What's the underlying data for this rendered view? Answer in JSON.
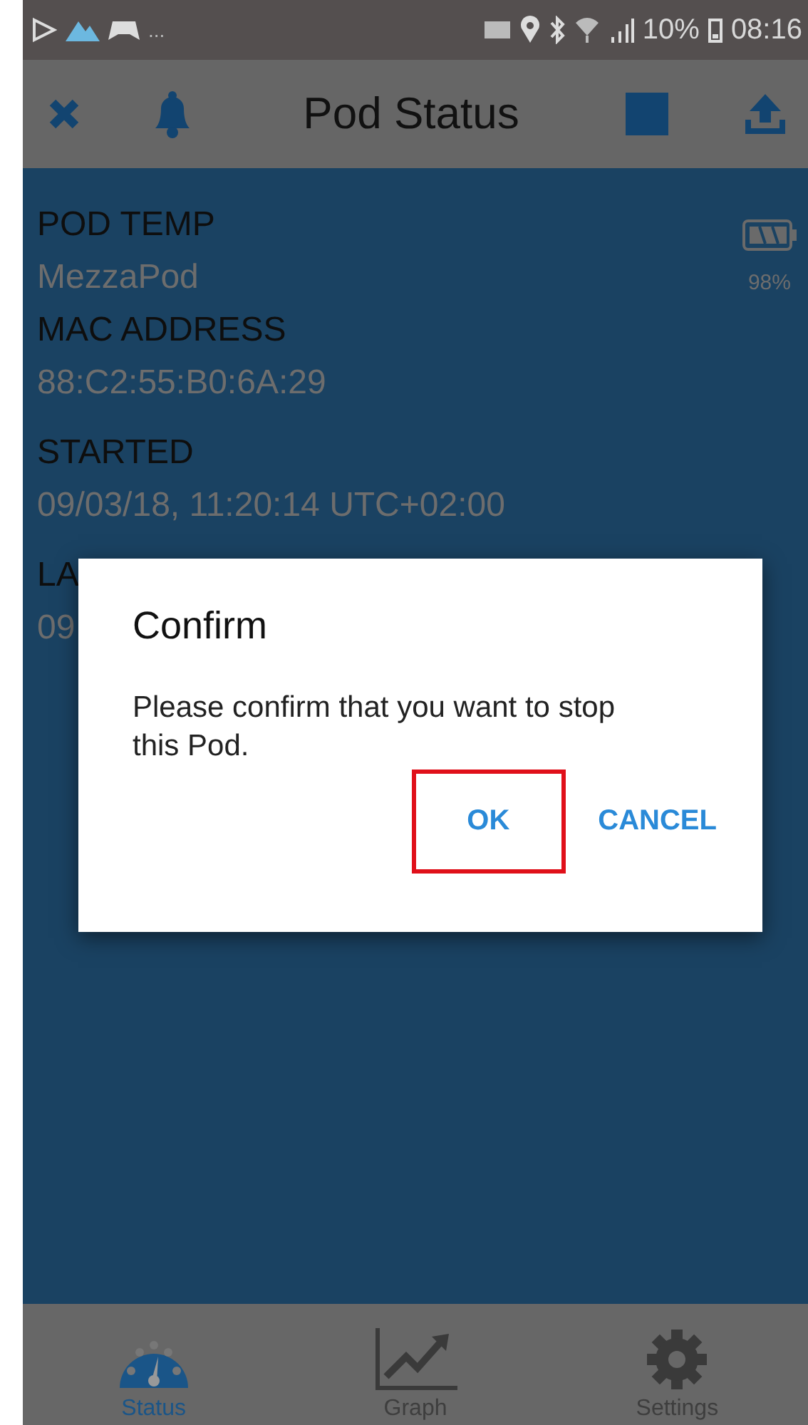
{
  "status_bar": {
    "overflow": "...",
    "battery": "10%",
    "time": "08:16"
  },
  "app_bar": {
    "title": "Pod Status"
  },
  "fields": [
    {
      "label": "POD TEMP",
      "value": "MezzaPod"
    },
    {
      "label": "MAC ADDRESS",
      "value": "88:C2:55:B0:6A:29"
    },
    {
      "label": "STARTED",
      "value": "09/03/18, 11:20:14 UTC+02:00"
    },
    {
      "label": "LA",
      "value": "09"
    }
  ],
  "pod_battery": {
    "reading": "98%"
  },
  "dialog": {
    "title": "Confirm",
    "message": "Please confirm that you want to stop this Pod.",
    "buttons": [
      {
        "label": "OK",
        "highlighted": true
      },
      {
        "label": "CANCEL",
        "highlighted": false
      }
    ]
  },
  "bottom_nav": [
    {
      "label": "Status",
      "kind": "gauge",
      "selected": true
    },
    {
      "label": "Graph",
      "kind": "graph",
      "selected": false
    },
    {
      "label": "Settings",
      "kind": "gear",
      "selected": false
    }
  ]
}
